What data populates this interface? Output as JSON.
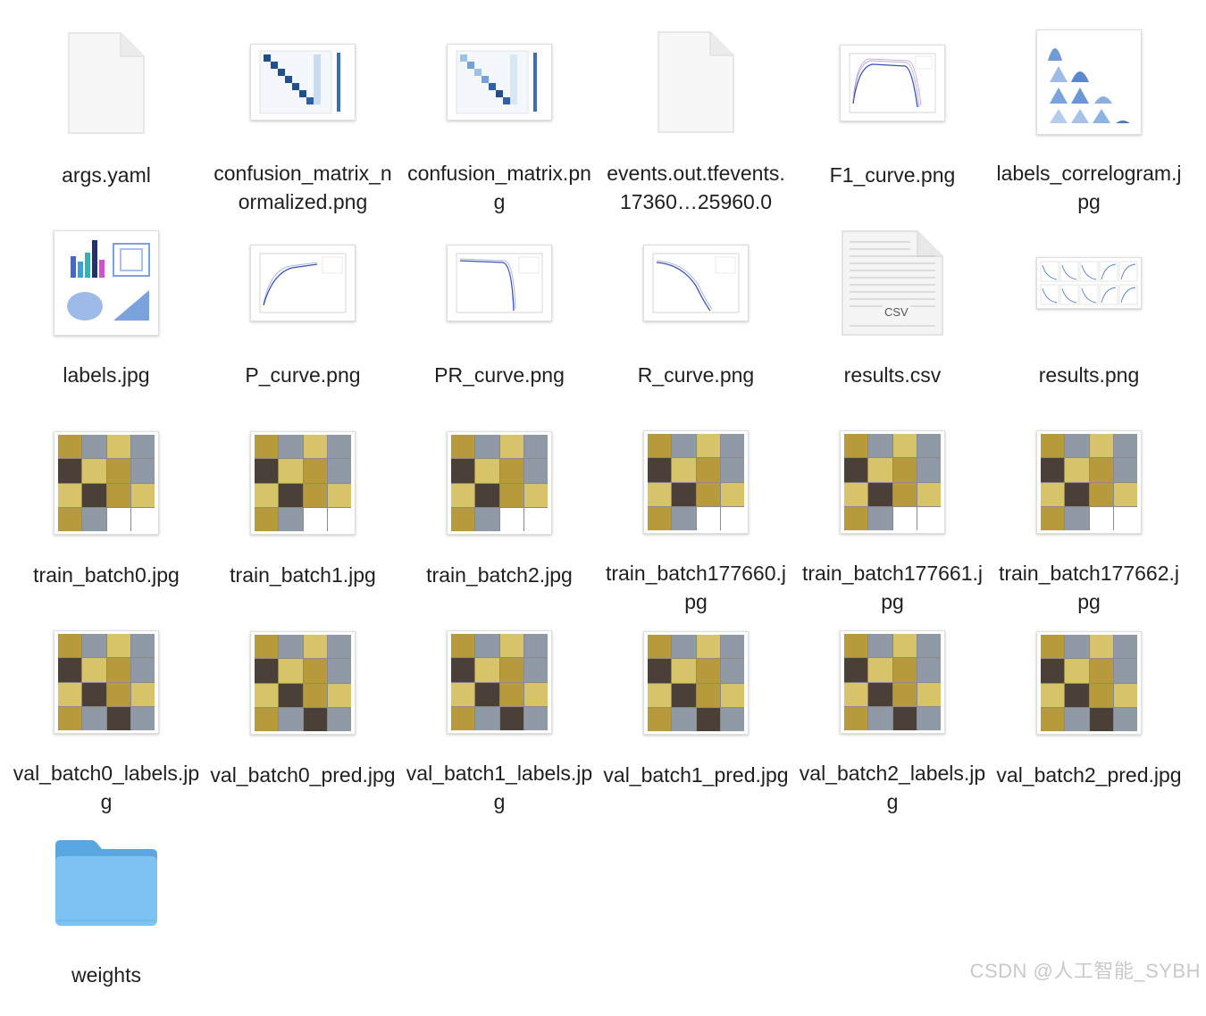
{
  "files": [
    {
      "name": "args.yaml",
      "icon": "document-icon"
    },
    {
      "name": "confusion_matrix_normalized.png",
      "icon": "matrix-thumbnail-icon"
    },
    {
      "name": "confusion_matrix.png",
      "icon": "matrix-thumbnail-icon"
    },
    {
      "name": "events.out.tfevents.17360…25960.0",
      "icon": "document-icon"
    },
    {
      "name": "F1_curve.png",
      "icon": "curve-thumbnail-icon"
    },
    {
      "name": "labels_correlogram.jpg",
      "icon": "correlogram-thumbnail-icon"
    },
    {
      "name": "labels.jpg",
      "icon": "labels-thumbnail-icon"
    },
    {
      "name": "P_curve.png",
      "icon": "curve-thumbnail-icon"
    },
    {
      "name": "PR_curve.png",
      "icon": "curve-thumbnail-icon"
    },
    {
      "name": "R_curve.png",
      "icon": "curve-thumbnail-icon"
    },
    {
      "name": "results.csv",
      "icon": "csv-document-icon",
      "badge": "CSV"
    },
    {
      "name": "results.png",
      "icon": "results-thumbnail-icon"
    },
    {
      "name": "train_batch0.jpg",
      "icon": "image-mosaic-icon"
    },
    {
      "name": "train_batch1.jpg",
      "icon": "image-mosaic-icon"
    },
    {
      "name": "train_batch2.jpg",
      "icon": "image-mosaic-icon"
    },
    {
      "name": "train_batch177660.jpg",
      "icon": "image-mosaic-icon"
    },
    {
      "name": "train_batch177661.jpg",
      "icon": "image-mosaic-icon"
    },
    {
      "name": "train_batch177662.jpg",
      "icon": "image-mosaic-icon"
    },
    {
      "name": "val_batch0_labels.jpg",
      "icon": "image-mosaic-icon"
    },
    {
      "name": "val_batch0_pred.jpg",
      "icon": "image-mosaic-icon"
    },
    {
      "name": "val_batch1_labels.jpg",
      "icon": "image-mosaic-icon"
    },
    {
      "name": "val_batch1_pred.jpg",
      "icon": "image-mosaic-icon"
    },
    {
      "name": "val_batch2_labels.jpg",
      "icon": "image-mosaic-icon"
    },
    {
      "name": "val_batch2_pred.jpg",
      "icon": "image-mosaic-icon"
    },
    {
      "name": "weights",
      "icon": "folder-icon"
    }
  ],
  "watermark": "CSDN @人工智能_SYBH",
  "colors": {
    "folder": "#7cc2f2",
    "folder_tab": "#5aa6e0",
    "matrix": "#1f4f8f"
  }
}
